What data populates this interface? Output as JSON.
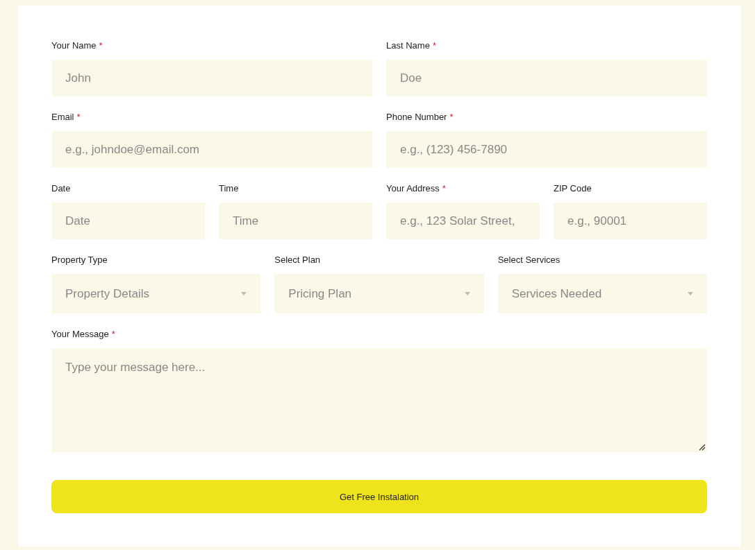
{
  "form": {
    "rows": [
      {
        "fields": [
          {
            "kind": "text",
            "label": "Your Name",
            "required_mark": "*",
            "placeholder": "John"
          },
          {
            "kind": "text",
            "label": "Last Name",
            "required_mark": "*",
            "placeholder": "Doe"
          }
        ]
      },
      {
        "fields": [
          {
            "kind": "text",
            "label": "Email",
            "required_mark": "*",
            "placeholder": "e.g., johndoe@email.com"
          },
          {
            "kind": "text",
            "label": "Phone Number",
            "required_mark": "*",
            "placeholder": "e.g., (123) 456-7890"
          }
        ]
      },
      {
        "fields": [
          {
            "kind": "text",
            "label": "Date",
            "placeholder": "Date"
          },
          {
            "kind": "text",
            "label": "Time",
            "placeholder": "Time"
          },
          {
            "kind": "text",
            "label": "Your Address",
            "required_mark": "*",
            "placeholder": "e.g., 123 Solar Street,"
          },
          {
            "kind": "text",
            "label": "ZIP Code",
            "placeholder": "e.g., 90001"
          }
        ]
      },
      {
        "fields": [
          {
            "kind": "select",
            "label": "Property Type",
            "placeholder": "Property Details"
          },
          {
            "kind": "select",
            "label": "Select Plan",
            "placeholder": "Pricing Plan"
          },
          {
            "kind": "select",
            "label": "Select Services",
            "placeholder": "Services Needed"
          }
        ]
      },
      {
        "fields": [
          {
            "kind": "textarea",
            "label": "Your Message",
            "required_mark": "*",
            "placeholder": "Type your message here..."
          }
        ]
      }
    ],
    "submit": {
      "label": "Get Free Instalation"
    }
  }
}
